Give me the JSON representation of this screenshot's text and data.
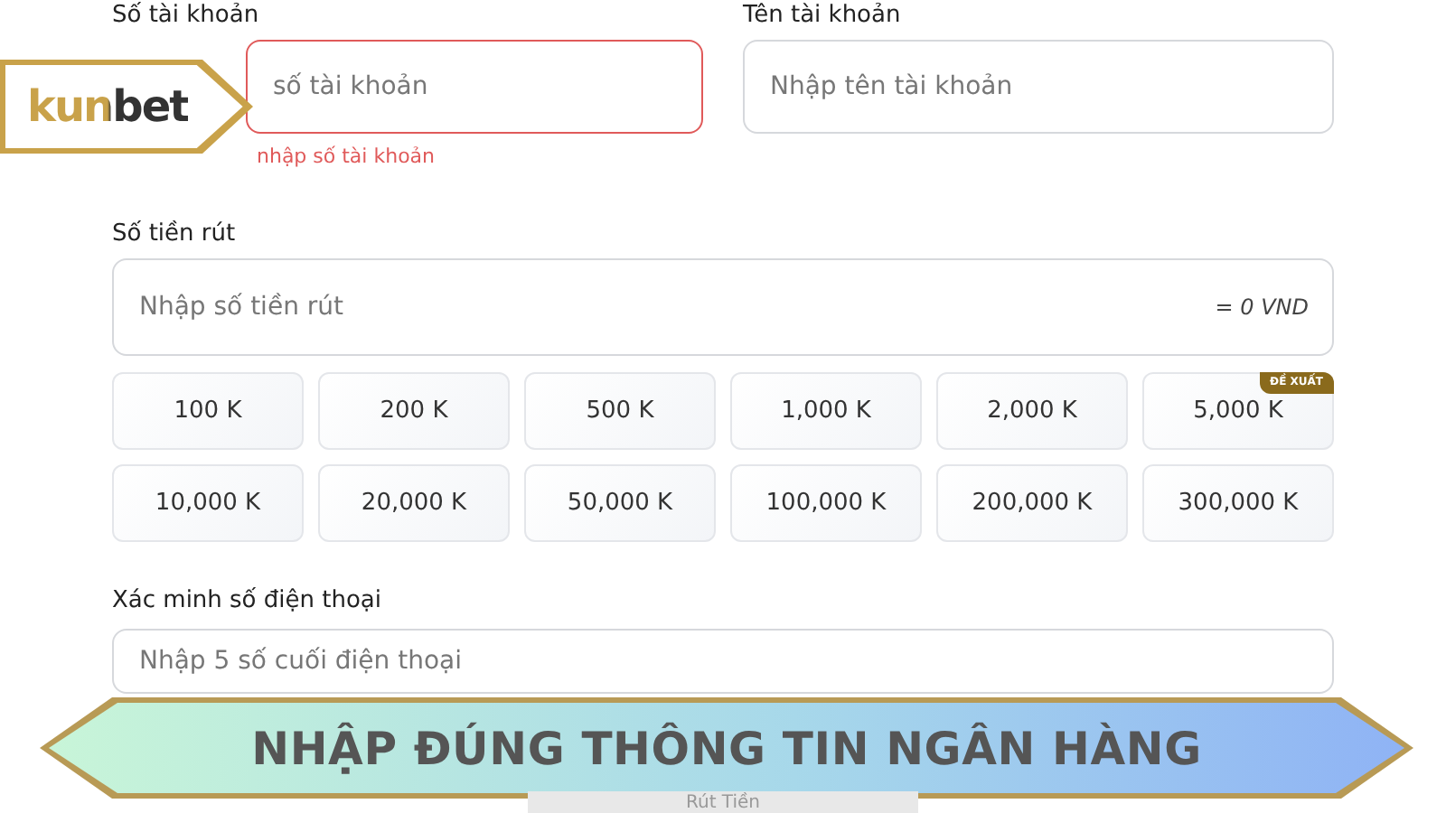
{
  "logo": {
    "text": "kunbet"
  },
  "account_number": {
    "label": "Số tài khoản",
    "placeholder": "số tài khoản",
    "error": "nhập số tài khoản",
    "invalid": true
  },
  "account_name": {
    "label": "Tên tài khoản",
    "placeholder": "Nhập tên tài khoản",
    "invalid": false
  },
  "amount": {
    "label": "Số tiền rút",
    "placeholder": "Nhập số tiền rút",
    "converted": "= 0 VND"
  },
  "amount_options": [
    {
      "label": "100 K"
    },
    {
      "label": "200 K"
    },
    {
      "label": "500 K"
    },
    {
      "label": "1,000 K"
    },
    {
      "label": "2,000 K"
    },
    {
      "label": "5,000 K",
      "badge": "ĐỀ XUẤT"
    },
    {
      "label": "10,000 K"
    },
    {
      "label": "20,000 K"
    },
    {
      "label": "50,000 K"
    },
    {
      "label": "100,000 K"
    },
    {
      "label": "200,000 K"
    },
    {
      "label": "300,000 K"
    }
  ],
  "phone": {
    "label": "Xác minh số điện thoại",
    "placeholder": "Nhập 5 số cuối điện thoại"
  },
  "banner": {
    "text": "NHẬP ĐÚNG THÔNG TIN NGÂN HÀNG"
  },
  "submit": {
    "label": "Rút Tiền"
  }
}
